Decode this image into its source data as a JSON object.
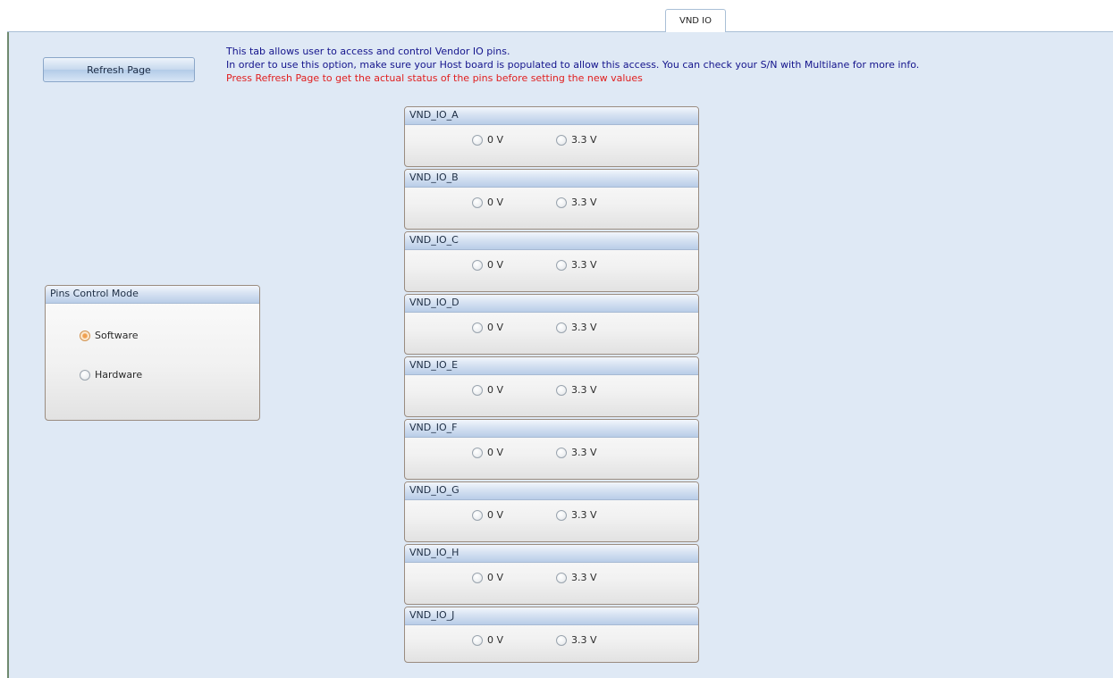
{
  "tab": {
    "label": "VND IO"
  },
  "toolbar": {
    "refresh_label": "Refresh Page"
  },
  "description": {
    "line1": "This tab allows user to access and control Vendor IO pins.",
    "line2": "In order to use this option, make sure your Host board is populated to allow this access. You can check your S/N with Multilane for more info.",
    "warning": "Press Refresh Page to get the actual status of the pins before setting the new values"
  },
  "control_mode": {
    "title": "Pins Control Mode",
    "options": [
      "Software",
      "Hardware"
    ],
    "selected": "Software"
  },
  "pins": [
    {
      "name": "VND_IO_A",
      "opt0": "0 V",
      "opt1": "3.3 V"
    },
    {
      "name": "VND_IO_B",
      "opt0": "0 V",
      "opt1": "3.3 V"
    },
    {
      "name": "VND_IO_C",
      "opt0": "0 V",
      "opt1": "3.3 V"
    },
    {
      "name": "VND_IO_D",
      "opt0": "0 V",
      "opt1": "3.3 V"
    },
    {
      "name": "VND_IO_E",
      "opt0": "0 V",
      "opt1": "3.3 V"
    },
    {
      "name": "VND_IO_F",
      "opt0": "0 V",
      "opt1": "3.3 V"
    },
    {
      "name": "VND_IO_G",
      "opt0": "0 V",
      "opt1": "3.3 V"
    },
    {
      "name": "VND_IO_H",
      "opt0": "0 V",
      "opt1": "3.3 V"
    },
    {
      "name": "VND_IO_J",
      "opt0": "0 V",
      "opt1": "3.3 V"
    }
  ],
  "colors": {
    "panel_bg": "#dfe9f5",
    "description_text": "#14148c",
    "warning_text": "#e02020",
    "selected_radio": "#f0a050"
  }
}
